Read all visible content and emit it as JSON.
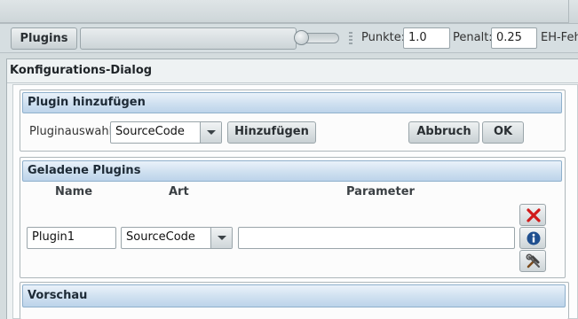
{
  "toolbar": {
    "plugins_label": "Plugins",
    "punkte_label": "Punkte:",
    "punkte_value": "1.0",
    "penalt_label": "Penalt:",
    "penalt_value": "0.25",
    "eh_label": "EH-Fehl"
  },
  "dialog": {
    "title": "Konfigurations-Dialog",
    "add_panel": {
      "title": "Plugin hinzufügen",
      "select_label": "Pluginauswahl:",
      "select_value": "SourceCode",
      "add_button": "Hinzufügen",
      "cancel_button": "Abbruch",
      "ok_button": "OK"
    },
    "loaded_panel": {
      "title": "Geladene Plugins",
      "columns": {
        "name": "Name",
        "art": "Art",
        "parameter": "Parameter"
      },
      "row": {
        "name": "Plugin1",
        "art": "SourceCode",
        "parameter": ""
      }
    },
    "preview_panel": {
      "title": "Vorschau"
    }
  },
  "icons": {
    "remove": "delete-x-icon",
    "info": "info-icon",
    "config": "tools-icon"
  },
  "colors": {
    "panel_header": "#cfe0f0",
    "delete_red": "#d11a1a",
    "info_blue": "#1f4f8f"
  }
}
